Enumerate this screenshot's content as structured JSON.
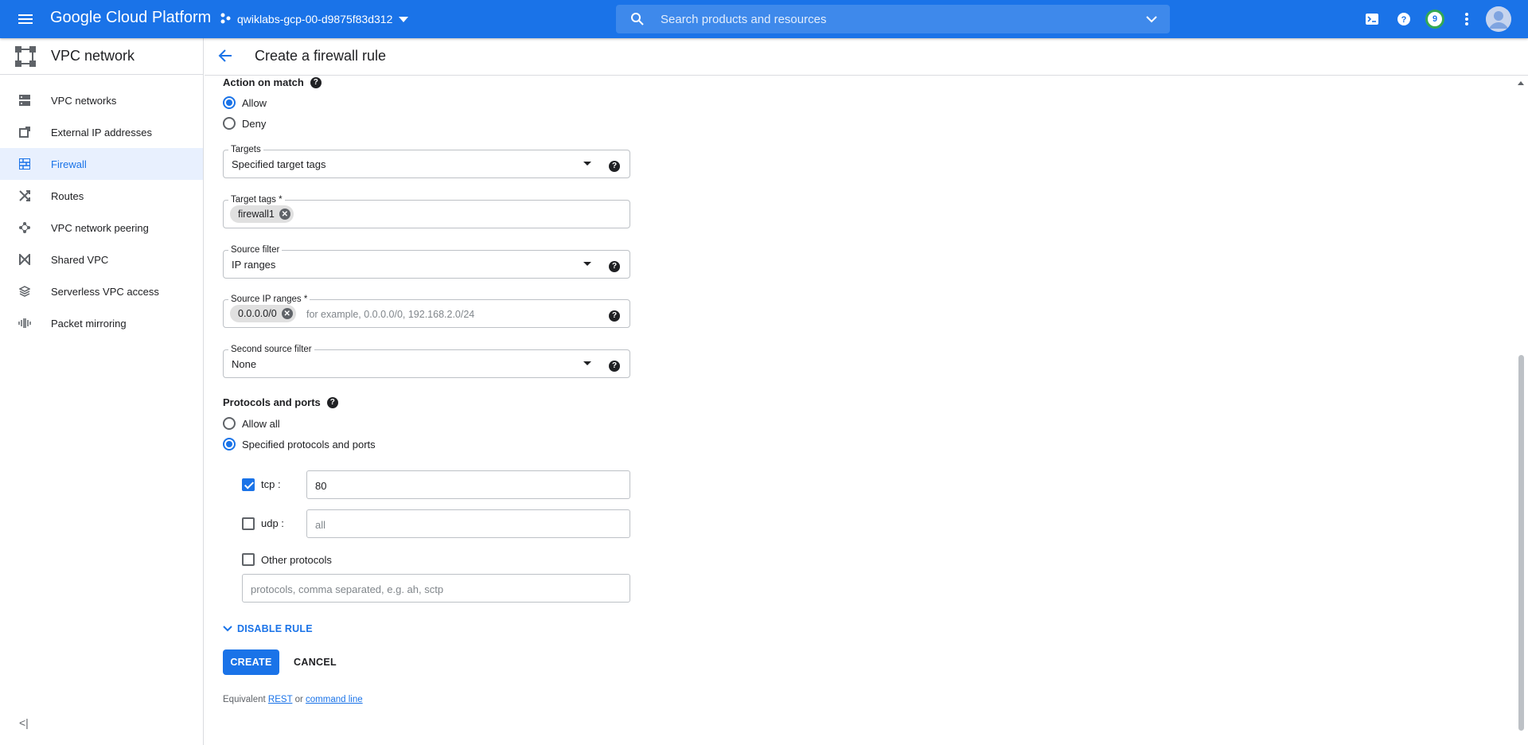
{
  "topbar": {
    "title": "Google Cloud Platform",
    "project": "qwiklabs-gcp-00-d9875f83d312",
    "search_placeholder": "Search products and resources",
    "notification_count": "9"
  },
  "sidebar": {
    "product": "VPC network",
    "items": [
      {
        "label": "VPC networks",
        "icon": "vpc-networks-icon"
      },
      {
        "label": "External IP addresses",
        "icon": "external-ip-icon"
      },
      {
        "label": "Firewall",
        "icon": "firewall-icon",
        "active": true
      },
      {
        "label": "Routes",
        "icon": "routes-icon"
      },
      {
        "label": "VPC network peering",
        "icon": "peering-icon"
      },
      {
        "label": "Shared VPC",
        "icon": "shared-vpc-icon"
      },
      {
        "label": "Serverless VPC access",
        "icon": "serverless-icon"
      },
      {
        "label": "Packet mirroring",
        "icon": "packet-mirroring-icon"
      }
    ],
    "collapse_glyph": "<|"
  },
  "page": {
    "title": "Create a firewall rule"
  },
  "form": {
    "action_on_match": {
      "label": "Action on match",
      "options": [
        "Allow",
        "Deny"
      ],
      "selected": "Allow"
    },
    "targets": {
      "label": "Targets",
      "value": "Specified target tags"
    },
    "target_tags": {
      "label": "Target tags *",
      "chips": [
        "firewall1"
      ]
    },
    "source_filter": {
      "label": "Source filter",
      "value": "IP ranges"
    },
    "source_ip_ranges": {
      "label": "Source IP ranges *",
      "chips": [
        "0.0.0.0/0"
      ],
      "placeholder": "for example, 0.0.0.0/0, 192.168.2.0/24"
    },
    "second_source_filter": {
      "label": "Second source filter",
      "value": "None"
    },
    "protocols_and_ports": {
      "label": "Protocols and ports",
      "options": [
        "Allow all",
        "Specified protocols and ports"
      ],
      "selected": "Specified protocols and ports",
      "tcp": {
        "label": "tcp :",
        "checked": true,
        "value": "80"
      },
      "udp": {
        "label": "udp :",
        "checked": false,
        "placeholder": "all"
      },
      "other": {
        "label": "Other protocols",
        "checked": false,
        "placeholder": "protocols, comma separated, e.g. ah, sctp"
      }
    },
    "disable_rule": "DISABLE RULE",
    "create": "CREATE",
    "cancel": "CANCEL",
    "equivalent": {
      "prefix": "Equivalent",
      "rest": "REST",
      "or": "or",
      "command_line": "command line"
    }
  },
  "colors": {
    "brand": "#1a73e8",
    "active_bg": "#e8f0fe",
    "badge_ring": "#34a853"
  }
}
